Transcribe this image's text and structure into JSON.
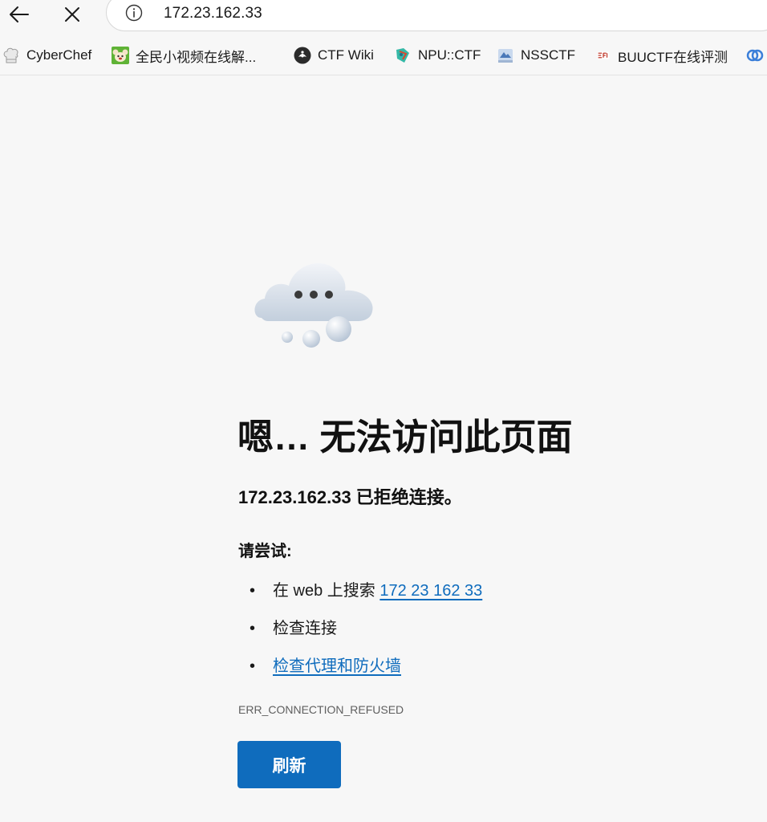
{
  "browser": {
    "address": "172.23.162.33",
    "icons": {
      "back": "back-arrow-icon",
      "close": "close-icon",
      "info": "info-icon"
    }
  },
  "bookmarks": [
    {
      "label": "CyberChef",
      "icon": "chef-hat-icon"
    },
    {
      "label": "全民小视频在线解...",
      "icon": "koala-icon"
    },
    {
      "label": "CTF Wiki",
      "icon": "ctf-wiki-logo-icon"
    },
    {
      "label": "NPU::CTF",
      "icon": "npu-ctf-icon"
    },
    {
      "label": "NSSCTF",
      "icon": "nssctf-icon"
    },
    {
      "label": "BUUCTF在线评测",
      "icon": "buuctf-icon"
    }
  ],
  "error_page": {
    "headline": "嗯… 无法访问此页面",
    "subheadline": "172.23.162.33 已拒绝连接。",
    "try_label": "请尝试:",
    "suggestions": [
      {
        "bullet": "•",
        "prefix": "在 web 上搜索 ",
        "link": "172 23 162 33"
      },
      {
        "bullet": "•",
        "text": "检查连接"
      },
      {
        "bullet": "•",
        "link": "检查代理和防火墙"
      }
    ],
    "error_code": "ERR_CONNECTION_REFUSED",
    "refresh_label": "刷新",
    "illustration": "cloud-icon"
  },
  "colors": {
    "background": "#f7f7f7",
    "accent": "#0f6cbd",
    "link": "#0f6cbd",
    "text": "#111111",
    "muted": "#5f5f5f"
  }
}
